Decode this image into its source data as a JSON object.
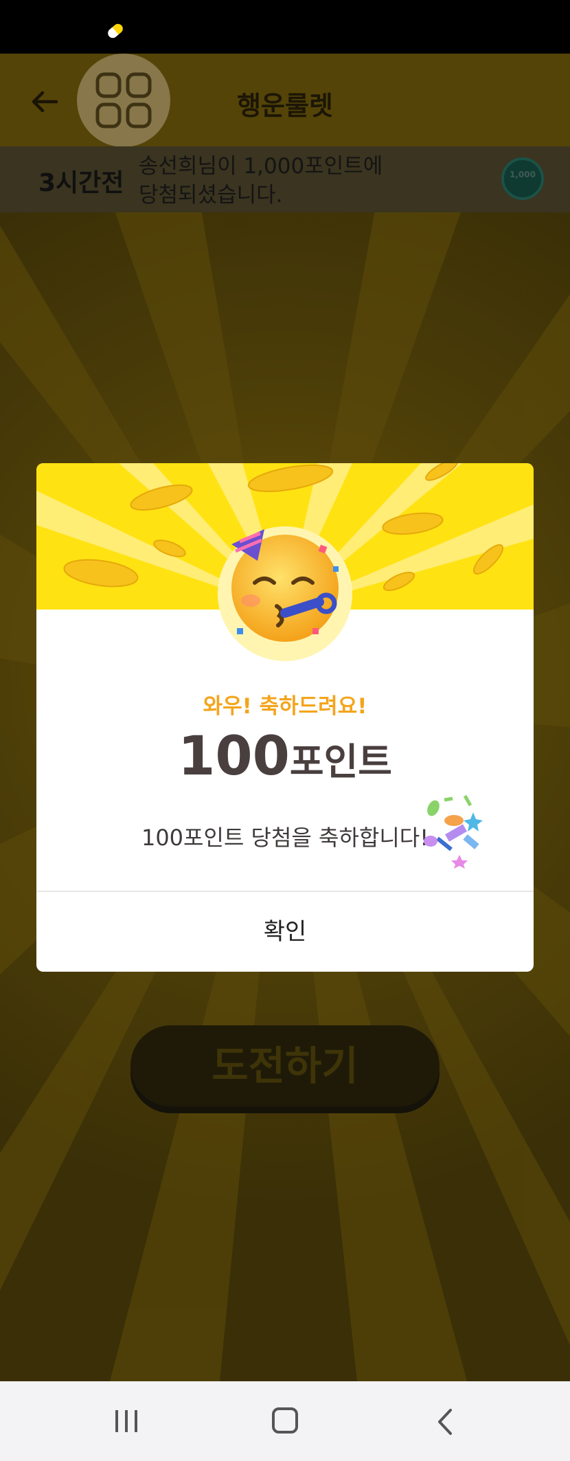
{
  "header": {
    "title": "행운룰렛"
  },
  "ticker": {
    "time_ago": "3시간전",
    "message": "송선희님이 1,000포인트에\n당첨되셨습니다.",
    "badge_text": "1,000"
  },
  "challenge_button": {
    "label": "도전하기"
  },
  "dialog": {
    "subtitle": "와우! 축하드려요!",
    "amount_number": "100",
    "amount_unit": "포인트",
    "message": "100포인트 당첨을 축하합니다!",
    "confirm_label": "확인"
  },
  "icons": {
    "back": "arrow-left-icon",
    "menu": "grid-menu-icon",
    "party": "partying-face-emoji",
    "confetti": "confetti-icon"
  },
  "colors": {
    "banner_yellow": "#ffe212",
    "subtitle_orange": "#f3a51c",
    "amount_text": "#4a3f3f"
  }
}
